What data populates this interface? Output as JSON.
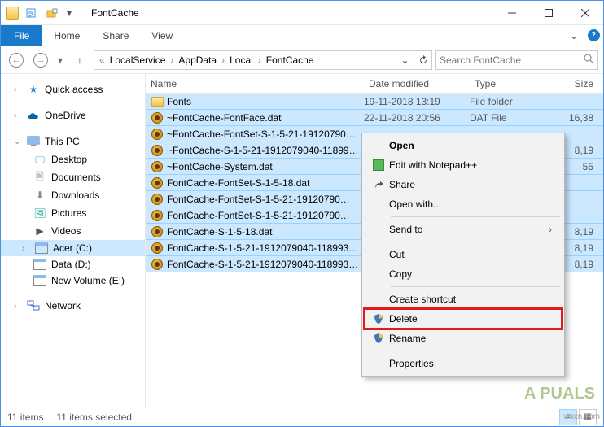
{
  "window": {
    "title": "FontCache"
  },
  "ribbon": {
    "file": "File",
    "tabs": [
      "Home",
      "Share",
      "View"
    ]
  },
  "breadcrumb": {
    "segments": [
      "LocalService",
      "AppData",
      "Local",
      "FontCache"
    ]
  },
  "search": {
    "placeholder": "Search FontCache"
  },
  "nav": {
    "quick_access": "Quick access",
    "onedrive": "OneDrive",
    "this_pc": "This PC",
    "this_pc_children": [
      {
        "label": "Desktop"
      },
      {
        "label": "Documents"
      },
      {
        "label": "Downloads"
      },
      {
        "label": "Pictures"
      },
      {
        "label": "Videos"
      },
      {
        "label": "Acer (C:)",
        "selected": true
      },
      {
        "label": "Data (D:)"
      },
      {
        "label": "New Volume (E:)"
      }
    ],
    "network": "Network"
  },
  "columns": {
    "name": "Name",
    "date": "Date modified",
    "type": "Type",
    "size": "Size"
  },
  "files": [
    {
      "name": "Fonts",
      "date": "19-11-2018 13:19",
      "type": "File folder",
      "size": "",
      "icon": "folder"
    },
    {
      "name": "~FontCache-FontFace.dat",
      "date": "22-11-2018 20:56",
      "type": "DAT File",
      "size": "16,38",
      "icon": "dat"
    },
    {
      "name": "~FontCache-FontSet-S-1-5-21-19120790…",
      "date": "",
      "type": "",
      "size": "",
      "icon": "dat"
    },
    {
      "name": "~FontCache-S-1-5-21-1912079040-11899…",
      "date": "",
      "type": "",
      "size": "8,19",
      "icon": "dat"
    },
    {
      "name": "~FontCache-System.dat",
      "date": "",
      "type": "",
      "size": "55",
      "icon": "dat"
    },
    {
      "name": "FontCache-FontSet-S-1-5-18.dat",
      "date": "",
      "type": "",
      "size": "",
      "icon": "dat"
    },
    {
      "name": "FontCache-FontSet-S-1-5-21-19120790…",
      "date": "",
      "type": "",
      "size": "",
      "icon": "dat"
    },
    {
      "name": "FontCache-FontSet-S-1-5-21-19120790…",
      "date": "",
      "type": "",
      "size": "",
      "icon": "dat"
    },
    {
      "name": "FontCache-S-1-5-18.dat",
      "date": "",
      "type": "",
      "size": "8,19",
      "icon": "dat"
    },
    {
      "name": "FontCache-S-1-5-21-1912079040-118993…",
      "date": "",
      "type": "",
      "size": "8,19",
      "icon": "dat"
    },
    {
      "name": "FontCache-S-1-5-21-1912079040-118993…",
      "date": "",
      "type": "",
      "size": "8,19",
      "icon": "dat"
    }
  ],
  "context_menu": {
    "open": "Open",
    "edit_npp": "Edit with Notepad++",
    "share": "Share",
    "open_with": "Open with...",
    "send_to": "Send to",
    "cut": "Cut",
    "copy": "Copy",
    "create_shortcut": "Create shortcut",
    "delete": "Delete",
    "rename": "Rename",
    "properties": "Properties"
  },
  "status": {
    "count": "11 items",
    "selected": "11 items selected"
  },
  "watermark": {
    "brand": "A  PUALS",
    "site": "wsxn.com"
  }
}
